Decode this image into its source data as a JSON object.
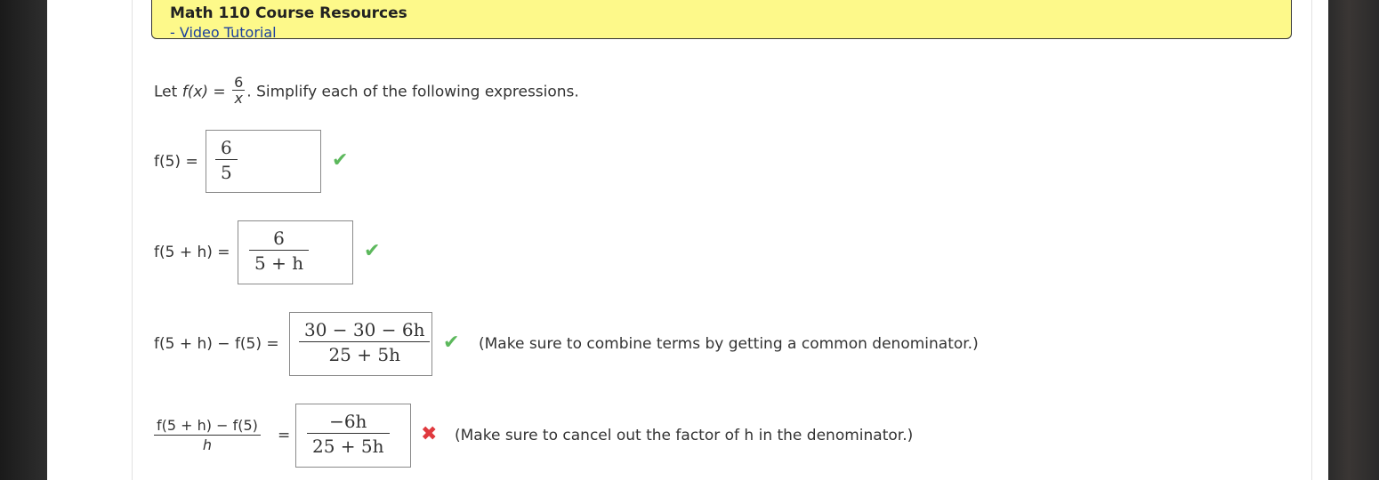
{
  "resources": {
    "title": "Math 110 Course Resources",
    "link": "- Video Tutorial"
  },
  "question": {
    "prefix": "Let ",
    "fx": "f(x)",
    "equals": " = ",
    "numerator": "6",
    "denominator": "x",
    "suffix": ". Simplify each of the following expressions."
  },
  "items": [
    {
      "label": "f(5) =",
      "answer_num": "6",
      "answer_den": "5",
      "status": "✔"
    },
    {
      "label": "f(5 + h) =",
      "answer_num": "6",
      "answer_den": "5 + h",
      "status": "✔"
    },
    {
      "label": "f(5 + h) − f(5) =",
      "answer_num": "30 − 30 − 6h",
      "answer_den": "25 + 5h",
      "status": "✔",
      "hint": "(Make sure to combine terms by getting a common denominator.)"
    },
    {
      "label_num": "f(5 + h) − f(5)",
      "label_den": "h",
      "equals": "=",
      "answer_num": "−6h",
      "answer_den": "25 + 5h",
      "status": "✖",
      "hint": "(Make sure to cancel out the factor of h in the denominator.)"
    }
  ],
  "colors": {
    "banner": "#fdf98a",
    "link": "#1a3fa0",
    "correct": "#5cb85c",
    "incorrect": "#e0393e"
  }
}
